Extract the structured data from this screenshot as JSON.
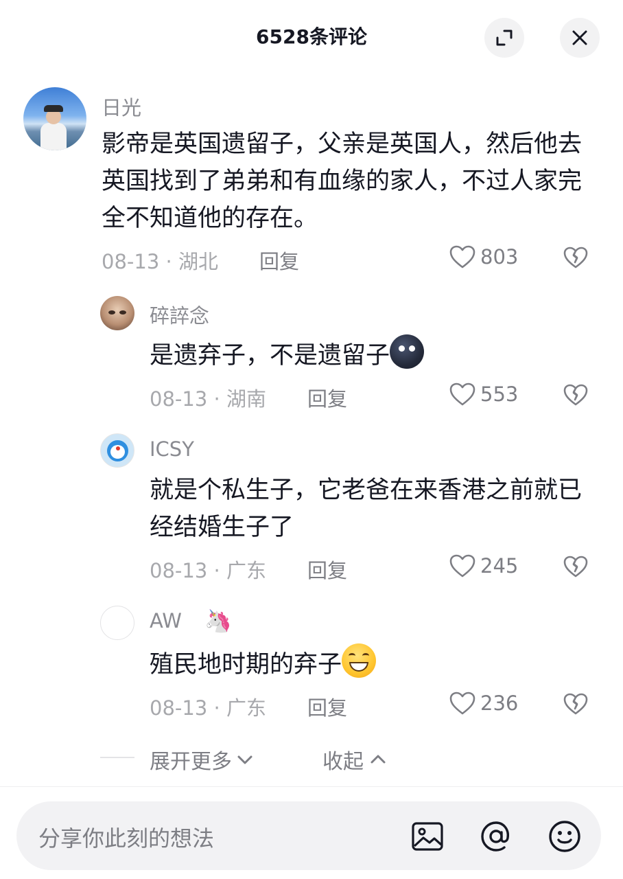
{
  "header": {
    "title": "6528条评论",
    "expand_icon": "expand-icon",
    "close_icon": "close-icon"
  },
  "comments": [
    {
      "username": "日光",
      "content": "影帝是英国遗留子，父亲是英国人，然后他去英国找到了弟弟和有血缘的家人，不过人家完全不知道他的存在。",
      "date": "08-13",
      "location": "湖北",
      "reply_label": "回复",
      "likes": "803"
    },
    {
      "username": "碎誶念",
      "content": "是遗弃子，不是遗留子",
      "emoji": "moon-face-emoji",
      "date": "08-13",
      "location": "湖南",
      "reply_label": "回复",
      "likes": "553"
    },
    {
      "username": "ICSY",
      "content": "就是个私生子，它老爸在来香港之前就已经结婚生子了",
      "date": "08-13",
      "location": "广东",
      "reply_label": "回复",
      "likes": "245"
    },
    {
      "username": "AW",
      "badge": "unicorn-icon",
      "content": "殖民地时期的弃子",
      "emoji": "grinning-emoji",
      "date": "08-13",
      "location": "广东",
      "reply_label": "回复",
      "likes": "236"
    }
  ],
  "replies_controls": {
    "expand_more": "展开更多",
    "collapse": "收起"
  },
  "composer": {
    "placeholder": "分享你此刻的想法",
    "image_icon": "image-icon",
    "mention_icon": "at-icon",
    "emoji_icon": "emoji-icon"
  },
  "colors": {
    "text_primary": "#161823",
    "text_secondary": "#8a8b91",
    "background": "#ffffff",
    "input_bg": "#f2f2f4"
  }
}
